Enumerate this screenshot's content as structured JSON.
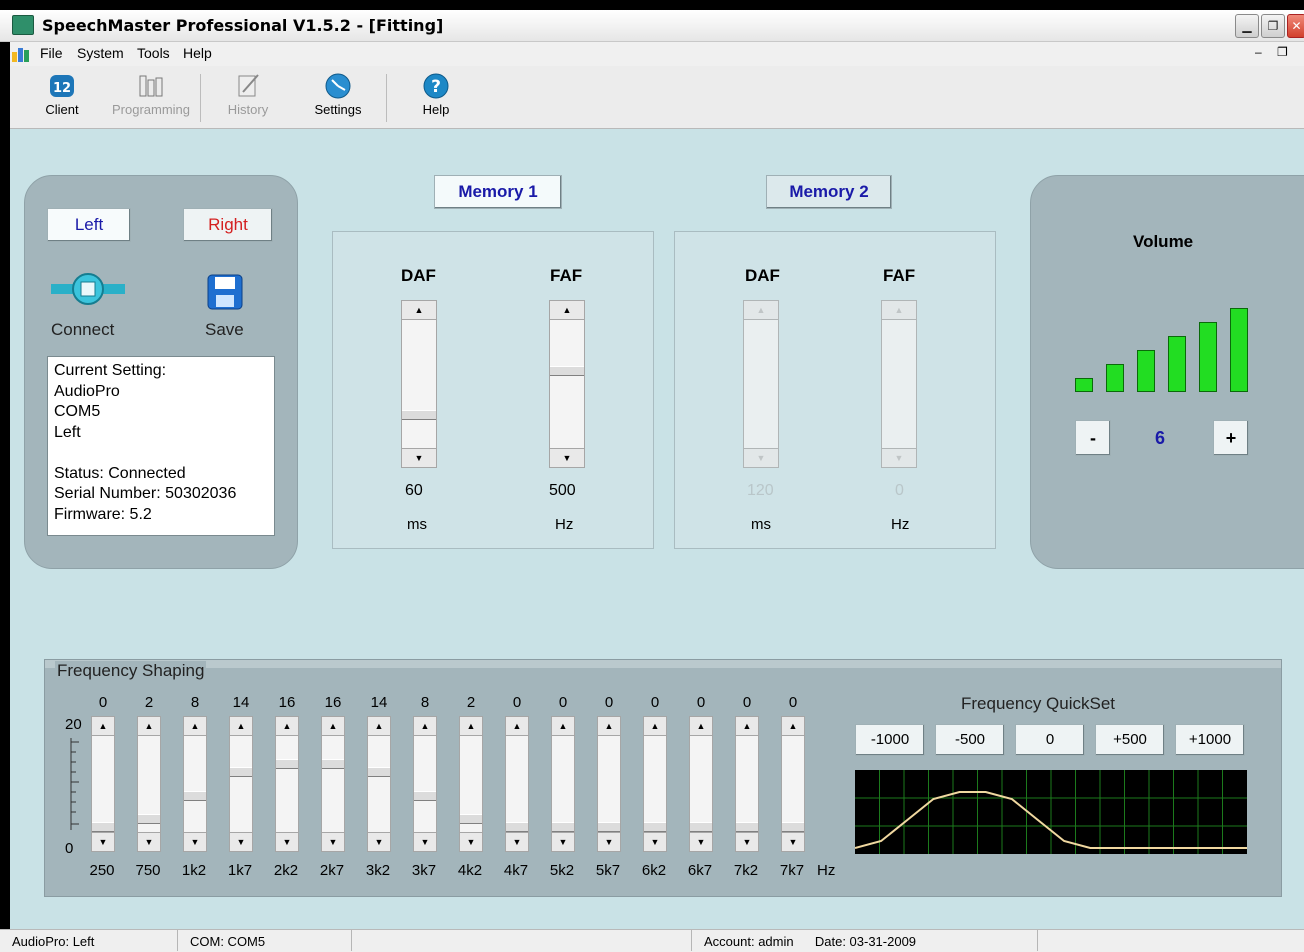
{
  "window": {
    "title": "SpeechMaster Professional V1.5.2 - [Fitting]"
  },
  "menu": [
    "File",
    "System",
    "Tools",
    "Help"
  ],
  "toolbar": [
    {
      "label": "Client",
      "icon": "client-icon",
      "enabled": true
    },
    {
      "label": "Programming",
      "icon": "programming-icon",
      "enabled": false
    },
    {
      "label": "History",
      "icon": "history-icon",
      "enabled": false
    },
    {
      "label": "Settings",
      "icon": "settings-icon",
      "enabled": true
    },
    {
      "label": "Help",
      "icon": "help-icon",
      "enabled": true
    }
  ],
  "device": {
    "left_label": "Left",
    "right_label": "Right",
    "connect_label": "Connect",
    "save_label": "Save",
    "info_lines": [
      "Current Setting:",
      "AudioPro",
      "COM5",
      "Left",
      "",
      "Status:  Connected",
      "Serial Number: 50302036",
      "Firmware: 5.2"
    ]
  },
  "memory1": {
    "label": "Memory 1",
    "daf": {
      "title": "DAF",
      "value": "60",
      "unit": "ms",
      "level": 0.25
    },
    "faf": {
      "title": "FAF",
      "value": "500",
      "unit": "Hz",
      "level": 0.62
    }
  },
  "memory2": {
    "label": "Memory 2",
    "daf": {
      "title": "DAF",
      "value": "120",
      "unit": "ms"
    },
    "faf": {
      "title": "FAF",
      "value": "0",
      "unit": "Hz"
    }
  },
  "volume": {
    "title": "Volume",
    "value": "6",
    "minus": "-",
    "plus": "+",
    "bars": 6
  },
  "frequency_shaping": {
    "title": "Frequency Shaping",
    "scale_top": "20",
    "scale_bottom": "0",
    "unit": "Hz",
    "bands": [
      {
        "freq": "250",
        "gain": "0"
      },
      {
        "freq": "750",
        "gain": "2"
      },
      {
        "freq": "1k2",
        "gain": "8"
      },
      {
        "freq": "1k7",
        "gain": "14"
      },
      {
        "freq": "2k2",
        "gain": "16"
      },
      {
        "freq": "2k7",
        "gain": "16"
      },
      {
        "freq": "3k2",
        "gain": "14"
      },
      {
        "freq": "3k7",
        "gain": "8"
      },
      {
        "freq": "4k2",
        "gain": "2"
      },
      {
        "freq": "4k7",
        "gain": "0"
      },
      {
        "freq": "5k2",
        "gain": "0"
      },
      {
        "freq": "5k7",
        "gain": "0"
      },
      {
        "freq": "6k2",
        "gain": "0"
      },
      {
        "freq": "6k7",
        "gain": "0"
      },
      {
        "freq": "7k2",
        "gain": "0"
      },
      {
        "freq": "7k7",
        "gain": "0"
      }
    ]
  },
  "quickset": {
    "title": "Frequency QuickSet",
    "buttons": [
      "-1000",
      "-500",
      "0",
      "+500",
      "+1000"
    ]
  },
  "status": {
    "device": "AudioPro: Left",
    "com": "COM: COM5",
    "empty": "",
    "account": "Account: admin",
    "date": "Date: 03-31-2009"
  },
  "colors": {
    "panel": "#a3b5bb",
    "background": "#c9e2e6",
    "volume_bar": "#22dd22",
    "memory_label": "#1a1aa8",
    "right_label": "#d42020",
    "curve": "#f0d8a0"
  }
}
